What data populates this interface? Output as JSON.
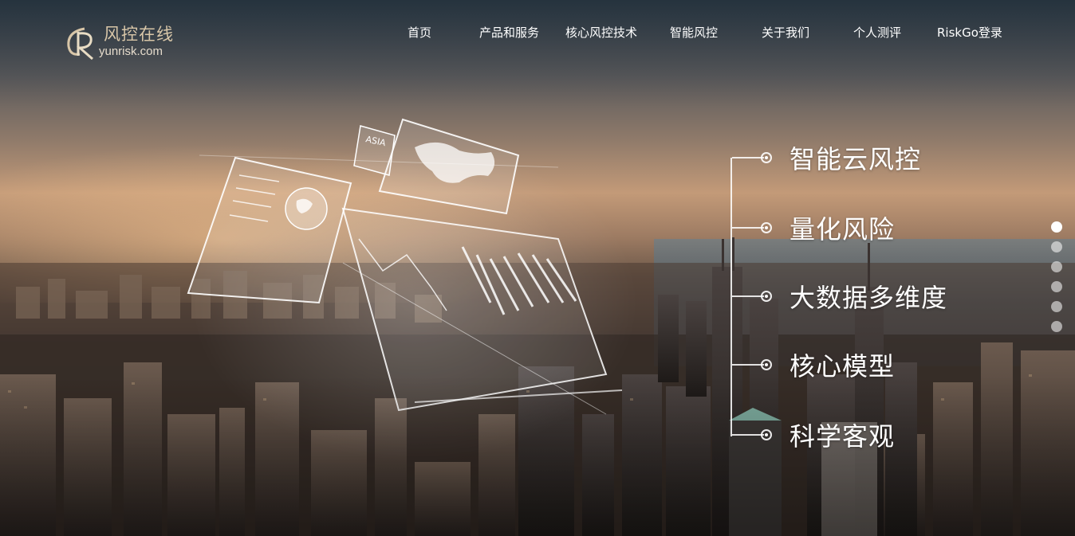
{
  "logo": {
    "name_cn": "风控在线",
    "domain": "yunrisk.com",
    "accent": "#d8c6a8"
  },
  "nav": {
    "items": [
      {
        "label": "首页"
      },
      {
        "label": "产品和服务"
      },
      {
        "label": "核心风控技术"
      },
      {
        "label": "智能风控"
      },
      {
        "label": "关于我们"
      },
      {
        "label": "个人测评"
      },
      {
        "label": "RiskGo登录"
      }
    ]
  },
  "hero": {
    "features": [
      {
        "label": "智能云风控"
      },
      {
        "label": "量化风险"
      },
      {
        "label": "大数据多维度"
      },
      {
        "label": "核心模型"
      },
      {
        "label": "科学客观"
      }
    ],
    "hologram_text": "ASIA"
  },
  "pager": {
    "count": 6,
    "active_index": 0
  }
}
